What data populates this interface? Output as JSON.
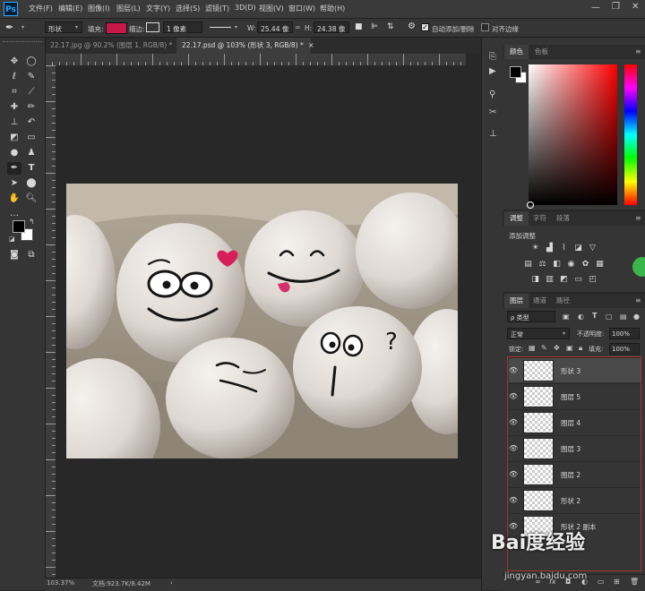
{
  "app": {
    "logo": "Ps"
  },
  "menu": [
    "文件(F)",
    "编辑(E)",
    "图像(I)",
    "图层(L)",
    "文字(Y)",
    "选择(S)",
    "滤镜(T)",
    "3D(D)",
    "视图(V)",
    "窗口(W)",
    "帮助(H)"
  ],
  "options": {
    "mode": "形状",
    "fill_label": "填充:",
    "fill_color": "#c8184a",
    "stroke_label": "描边:",
    "stroke_width": "1 像素",
    "w_label": "W:",
    "w_value": "25.44 像",
    "h_label": "H:",
    "h_value": "24.38 像",
    "auto_add_delete": "自动添加/删除",
    "align_edges": "对齐边缘"
  },
  "tabs": [
    {
      "label": "22.17.jpg @ 90.2% (图层 1, RGB/8) *",
      "active": false
    },
    {
      "label": "22.17.psd @ 103% (形状 3, RGB/8) *",
      "active": true
    }
  ],
  "status": {
    "zoom": "103.37%",
    "doc": "文档:923.7K/8.42M"
  },
  "colors": {
    "foreground": "#000000",
    "background": "#ffffff"
  },
  "color_panel": {
    "tabs": [
      "颜色",
      "色板"
    ]
  },
  "adjust_panel": {
    "tabs": [
      "调整",
      "字符",
      "段落"
    ],
    "title": "添加调整"
  },
  "layers_panel": {
    "tabs": [
      "图层",
      "通道",
      "路径"
    ],
    "kind_label": "ρ 类型",
    "blend_mode": "正常",
    "opacity_label": "不透明度:",
    "opacity_value": "100%",
    "lock_label": "锁定:",
    "fill_label": "填充:",
    "fill_value": "100%",
    "layers": [
      {
        "name": "形状 3",
        "selected": true
      },
      {
        "name": "图层 5",
        "selected": false
      },
      {
        "name": "图层 4",
        "selected": false
      },
      {
        "name": "图层 3",
        "selected": false
      },
      {
        "name": "图层 2",
        "selected": false
      },
      {
        "name": "形状 2",
        "selected": false
      },
      {
        "name": "形状 2 副本",
        "selected": false
      }
    ]
  },
  "watermark": {
    "brand": "Bai度经验",
    "url": "jingyan.baidu.com"
  },
  "canvas": {
    "annotation": "?"
  }
}
